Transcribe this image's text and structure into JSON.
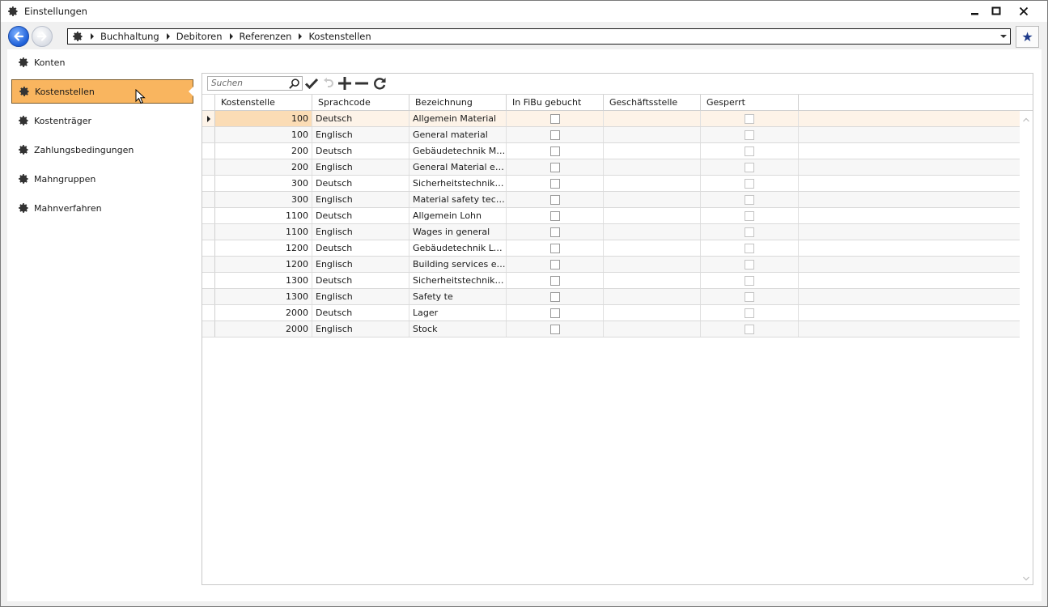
{
  "window": {
    "title": "Einstellungen",
    "icon": "gear-icon"
  },
  "breadcrumb": {
    "items": [
      "Buchhaltung",
      "Debitoren",
      "Referenzen",
      "Kostenstellen"
    ]
  },
  "sidebar": {
    "items": [
      {
        "label": "Konten",
        "icon": "gear-icon"
      },
      {
        "label": "Kostenstellen",
        "icon": "gear-icon",
        "active": true
      },
      {
        "label": "Kostenträger",
        "icon": "gear-icon"
      },
      {
        "label": "Zahlungsbedingungen",
        "icon": "gear-icon"
      },
      {
        "label": "Mahngruppen",
        "icon": "gear-icon"
      },
      {
        "label": "Mahnverfahren",
        "icon": "gear-icon"
      }
    ]
  },
  "toolbar": {
    "search_placeholder": "Suchen"
  },
  "colors": {
    "active_item": "#f9b55f",
    "selected_row": "#fdf3e8",
    "selected_cell": "#fbdcb5",
    "nav_blue": "#1d5fd8"
  },
  "table": {
    "columns": [
      "Kostenstelle",
      "Sprachcode",
      "Bezeichnung",
      "In FiBu gebucht",
      "Geschäftsstelle",
      "Gesperrt"
    ],
    "rows": [
      {
        "kostenstelle": "100",
        "sprachcode": "Deutsch",
        "bezeichnung": "Allgemein Material",
        "gebucht": false,
        "geschaeftsstelle": "",
        "gesperrt": false
      },
      {
        "kostenstelle": "100",
        "sprachcode": "Englisch",
        "bezeichnung": "General material",
        "gebucht": false,
        "geschaeftsstelle": "",
        "gesperrt": false
      },
      {
        "kostenstelle": "200",
        "sprachcode": "Deutsch",
        "bezeichnung": "Gebäudetechnik Mat…",
        "gebucht": false,
        "geschaeftsstelle": "",
        "gesperrt": false
      },
      {
        "kostenstelle": "200",
        "sprachcode": "Englisch",
        "bezeichnung": "General Material ele…",
        "gebucht": false,
        "geschaeftsstelle": "",
        "gesperrt": false
      },
      {
        "kostenstelle": "300",
        "sprachcode": "Deutsch",
        "bezeichnung": "Sicherheitstechnik M…",
        "gebucht": false,
        "geschaeftsstelle": "",
        "gesperrt": false
      },
      {
        "kostenstelle": "300",
        "sprachcode": "Englisch",
        "bezeichnung": "Material safety tech…",
        "gebucht": false,
        "geschaeftsstelle": "",
        "gesperrt": false
      },
      {
        "kostenstelle": "1100",
        "sprachcode": "Deutsch",
        "bezeichnung": "Allgemein Lohn",
        "gebucht": false,
        "geschaeftsstelle": "",
        "gesperrt": false
      },
      {
        "kostenstelle": "1100",
        "sprachcode": "Englisch",
        "bezeichnung": "Wages in general",
        "gebucht": false,
        "geschaeftsstelle": "",
        "gesperrt": false
      },
      {
        "kostenstelle": "1200",
        "sprachcode": "Deutsch",
        "bezeichnung": "Gebäudetechnik Lohn",
        "gebucht": false,
        "geschaeftsstelle": "",
        "gesperrt": false
      },
      {
        "kostenstelle": "1200",
        "sprachcode": "Englisch",
        "bezeichnung": "Building services eng…",
        "gebucht": false,
        "geschaeftsstelle": "",
        "gesperrt": false
      },
      {
        "kostenstelle": "1300",
        "sprachcode": "Deutsch",
        "bezeichnung": "Sicherheitstechnik L…",
        "gebucht": false,
        "geschaeftsstelle": "",
        "gesperrt": false
      },
      {
        "kostenstelle": "1300",
        "sprachcode": "Englisch",
        "bezeichnung": "Safety te",
        "gebucht": false,
        "geschaeftsstelle": "",
        "gesperrt": false
      },
      {
        "kostenstelle": "2000",
        "sprachcode": "Deutsch",
        "bezeichnung": "Lager",
        "gebucht": false,
        "geschaeftsstelle": "",
        "gesperrt": false
      },
      {
        "kostenstelle": "2000",
        "sprachcode": "Englisch",
        "bezeichnung": "Stock",
        "gebucht": false,
        "geschaeftsstelle": "",
        "gesperrt": false
      }
    ]
  }
}
